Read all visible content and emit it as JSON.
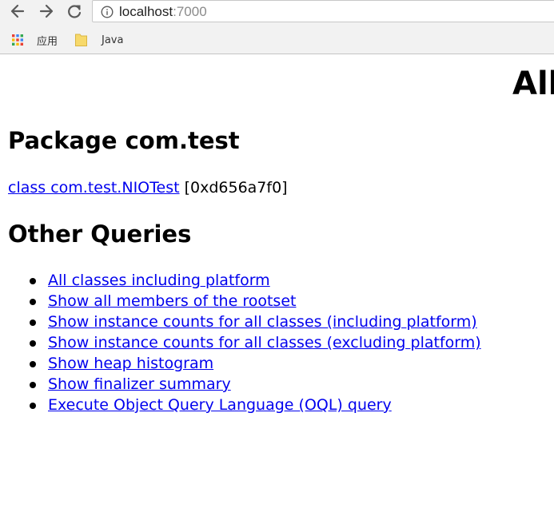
{
  "browser": {
    "url_host": "localhost",
    "url_port": ":7000",
    "bookmarks": [
      {
        "label": "应用",
        "icon": "apps-grid-icon"
      },
      {
        "label": "Java",
        "icon": "folder-icon"
      }
    ]
  },
  "page": {
    "heading": "All",
    "package_heading": "Package com.test",
    "class_link": "class com.test.NIOTest",
    "class_address": " [0xd656a7f0]",
    "other_heading": "Other Queries",
    "queries": [
      "All classes including platform",
      "Show all members of the rootset",
      "Show instance counts for all classes (including platform)",
      "Show instance counts for all classes (excluding platform)",
      "Show heap histogram",
      "Show finalizer summary",
      "Execute Object Query Language (OQL) query"
    ]
  },
  "colors": {
    "link": "#0000ee",
    "chrome_bg": "#f2f2f2",
    "folder_yellow": "#f7d96b"
  }
}
